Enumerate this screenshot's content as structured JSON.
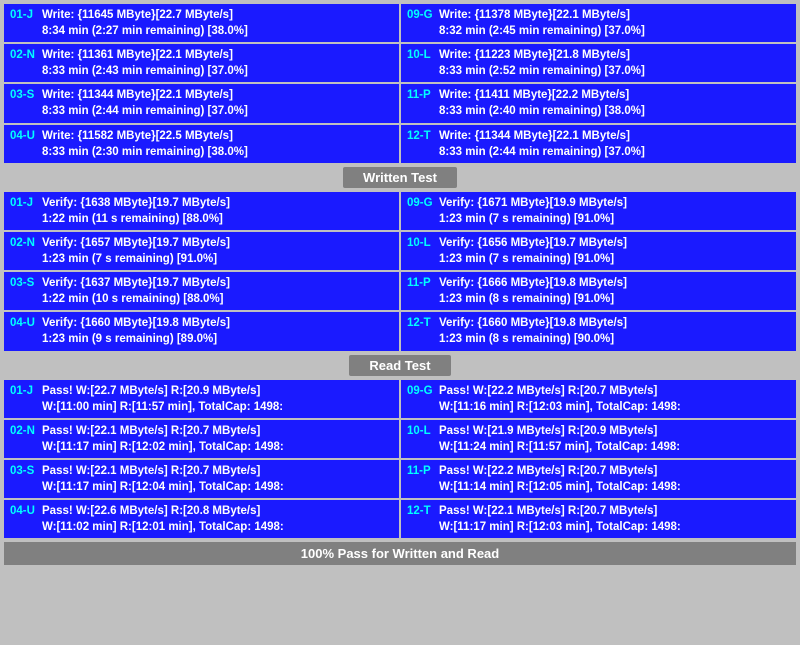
{
  "sections": {
    "written_test_label": "Written Test",
    "read_test_label": "Read Test",
    "bottom_status": "100% Pass for Written and Read"
  },
  "write_cards": [
    {
      "id": "01-J",
      "line1": "Write: {11645 MByte}[22.7 MByte/s]",
      "line2": "8:34 min (2:27 min remaining)  [38.0%]"
    },
    {
      "id": "09-G",
      "line1": "Write: {11378 MByte}[22.1 MByte/s]",
      "line2": "8:32 min (2:45 min remaining)  [37.0%]"
    },
    {
      "id": "02-N",
      "line1": "Write: {11361 MByte}[22.1 MByte/s]",
      "line2": "8:33 min (2:43 min remaining)  [37.0%]"
    },
    {
      "id": "10-L",
      "line1": "Write: {11223 MByte}[21.8 MByte/s]",
      "line2": "8:33 min (2:52 min remaining)  [37.0%]"
    },
    {
      "id": "03-S",
      "line1": "Write: {11344 MByte}[22.1 MByte/s]",
      "line2": "8:33 min (2:44 min remaining)  [37.0%]"
    },
    {
      "id": "11-P",
      "line1": "Write: {11411 MByte}[22.2 MByte/s]",
      "line2": "8:33 min (2:40 min remaining)  [38.0%]"
    },
    {
      "id": "04-U",
      "line1": "Write: {11582 MByte}[22.5 MByte/s]",
      "line2": "8:33 min (2:30 min remaining)  [38.0%]"
    },
    {
      "id": "12-T",
      "line1": "Write: {11344 MByte}[22.1 MByte/s]",
      "line2": "8:33 min (2:44 min remaining)  [37.0%]"
    }
  ],
  "verify_cards": [
    {
      "id": "01-J",
      "line1": "Verify: {1638 MByte}[19.7 MByte/s]",
      "line2": "1:22 min (11 s remaining)  [88.0%]"
    },
    {
      "id": "09-G",
      "line1": "Verify: {1671 MByte}[19.9 MByte/s]",
      "line2": "1:23 min (7 s remaining)  [91.0%]"
    },
    {
      "id": "02-N",
      "line1": "Verify: {1657 MByte}[19.7 MByte/s]",
      "line2": "1:23 min (7 s remaining)  [91.0%]"
    },
    {
      "id": "10-L",
      "line1": "Verify: {1656 MByte}[19.7 MByte/s]",
      "line2": "1:23 min (7 s remaining)  [91.0%]"
    },
    {
      "id": "03-S",
      "line1": "Verify: {1637 MByte}[19.7 MByte/s]",
      "line2": "1:22 min (10 s remaining)  [88.0%]"
    },
    {
      "id": "11-P",
      "line1": "Verify: {1666 MByte}[19.8 MByte/s]",
      "line2": "1:23 min (8 s remaining)  [91.0%]"
    },
    {
      "id": "04-U",
      "line1": "Verify: {1660 MByte}[19.8 MByte/s]",
      "line2": "1:23 min (9 s remaining)  [89.0%]"
    },
    {
      "id": "12-T",
      "line1": "Verify: {1660 MByte}[19.8 MByte/s]",
      "line2": "1:23 min (8 s remaining)  [90.0%]"
    }
  ],
  "pass_cards": [
    {
      "id": "01-J",
      "line1": "Pass! W:[22.7 MByte/s] R:[20.9 MByte/s]",
      "line2": "W:[11:00 min] R:[11:57 min], TotalCap: 1498:"
    },
    {
      "id": "09-G",
      "line1": "Pass! W:[22.2 MByte/s] R:[20.7 MByte/s]",
      "line2": "W:[11:16 min] R:[12:03 min], TotalCap: 1498:"
    },
    {
      "id": "02-N",
      "line1": "Pass! W:[22.1 MByte/s] R:[20.7 MByte/s]",
      "line2": "W:[11:17 min] R:[12:02 min], TotalCap: 1498:"
    },
    {
      "id": "10-L",
      "line1": "Pass! W:[21.9 MByte/s] R:[20.9 MByte/s]",
      "line2": "W:[11:24 min] R:[11:57 min], TotalCap: 1498:"
    },
    {
      "id": "03-S",
      "line1": "Pass! W:[22.1 MByte/s] R:[20.7 MByte/s]",
      "line2": "W:[11:17 min] R:[12:04 min], TotalCap: 1498:"
    },
    {
      "id": "11-P",
      "line1": "Pass! W:[22.2 MByte/s] R:[20.7 MByte/s]",
      "line2": "W:[11:14 min] R:[12:05 min], TotalCap: 1498:"
    },
    {
      "id": "04-U",
      "line1": "Pass! W:[22.6 MByte/s] R:[20.8 MByte/s]",
      "line2": "W:[11:02 min] R:[12:01 min], TotalCap: 1498:"
    },
    {
      "id": "12-T",
      "line1": "Pass! W:[22.1 MByte/s] R:[20.7 MByte/s]",
      "line2": "W:[11:17 min] R:[12:03 min], TotalCap: 1498:"
    }
  ]
}
